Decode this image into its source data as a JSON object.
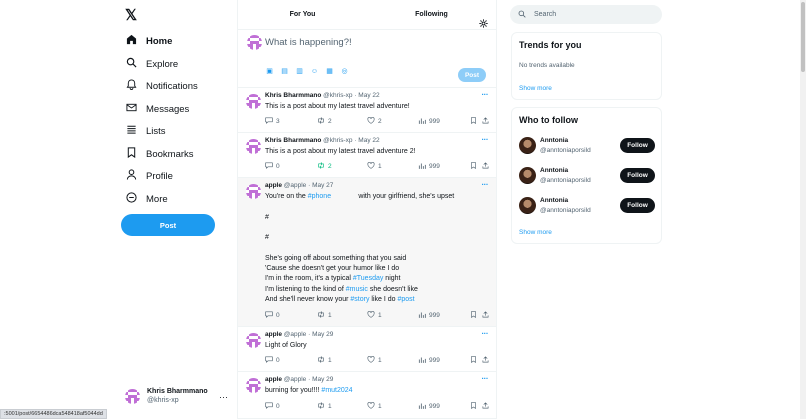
{
  "nav": {
    "logo": "𝕏",
    "items": [
      {
        "label": "Home",
        "icon": "home-icon"
      },
      {
        "label": "Explore",
        "icon": "search-icon"
      },
      {
        "label": "Notifications",
        "icon": "bell-icon"
      },
      {
        "label": "Messages",
        "icon": "mail-icon"
      },
      {
        "label": "Lists",
        "icon": "list-icon"
      },
      {
        "label": "Bookmarks",
        "icon": "bookmark-icon"
      },
      {
        "label": "Profile",
        "icon": "user-icon"
      },
      {
        "label": "More",
        "icon": "more-circle-icon"
      }
    ],
    "post_label": "Post"
  },
  "account": {
    "name": "Khris Bharmmano",
    "handle": "@khris-xp"
  },
  "status_url": ":5001/post/6654486dca548418af5044dd",
  "tabs": [
    "For You",
    "Following"
  ],
  "composer": {
    "placeholder": "What is happening?!",
    "post_label": "Post"
  },
  "tweets": [
    {
      "name": "Khris Bharmmano",
      "meta": "@khris-xp · May 22",
      "body": "This is a post about my latest travel adventure!",
      "replies": "3",
      "reposts": "2",
      "likes": "2",
      "views": "999",
      "repost_active": false
    },
    {
      "name": "Khris Bharmmano",
      "meta": "@khris-xp · May 22",
      "body": "This is a post about my latest travel adventure 2!",
      "replies": "0",
      "reposts": "2",
      "likes": "1",
      "views": "999",
      "repost_active": true
    },
    {
      "name": "apple",
      "meta": "@apple · May 27",
      "replies": "0",
      "reposts": "1",
      "likes": "1",
      "views": "999",
      "repost_active": false,
      "lines": {
        "l1a": "You're on the ",
        "l1tag": "#phone",
        "l1b": "              with your girlfriend, she's upset",
        "l2": "#",
        "l3": "#",
        "l4": "She's going off about something that you said",
        "l5": "'Cause she doesn't get your humor like I do",
        "l6a": "I'm in the room, it's a typical ",
        "l6tag": "#Tuesday",
        "l6b": " night",
        "l7a": "I'm listening to the kind of ",
        "l7tag": "#music",
        "l7b": " she doesn't like",
        "l8a": "And she'll never know your ",
        "l8tag": "#story",
        "l8b": " like I do ",
        "l8tag2": "#post"
      }
    },
    {
      "name": "apple",
      "meta": "@apple · May 29",
      "body": "Light of Glory",
      "replies": "0",
      "reposts": "1",
      "likes": "1",
      "views": "999",
      "repost_active": false
    },
    {
      "name": "apple",
      "meta": "@apple · May 29",
      "body_a": "burning for you!!!! ",
      "body_tag": "#mut2024",
      "replies": "0",
      "reposts": "1",
      "likes": "1",
      "views": "999",
      "repost_active": false
    }
  ],
  "search": {
    "placeholder": "Search"
  },
  "trends": {
    "title": "Trends for you",
    "empty": "No trends available",
    "show_more": "Show more"
  },
  "who_to_follow": {
    "title": "Who to follow",
    "users": [
      {
        "name": "Anntonia",
        "handle": "@anntoniaporsild",
        "button": "Follow"
      },
      {
        "name": "Anntonia",
        "handle": "@anntoniaporsild",
        "button": "Follow"
      },
      {
        "name": "Anntonia",
        "handle": "@anntoniaporsild",
        "button": "Follow"
      }
    ],
    "show_more": "Show more"
  },
  "colors": {
    "accent": "#1d9bf0",
    "repost_active": "#00ba7c",
    "avatar_pixel": "#c06fd6"
  }
}
